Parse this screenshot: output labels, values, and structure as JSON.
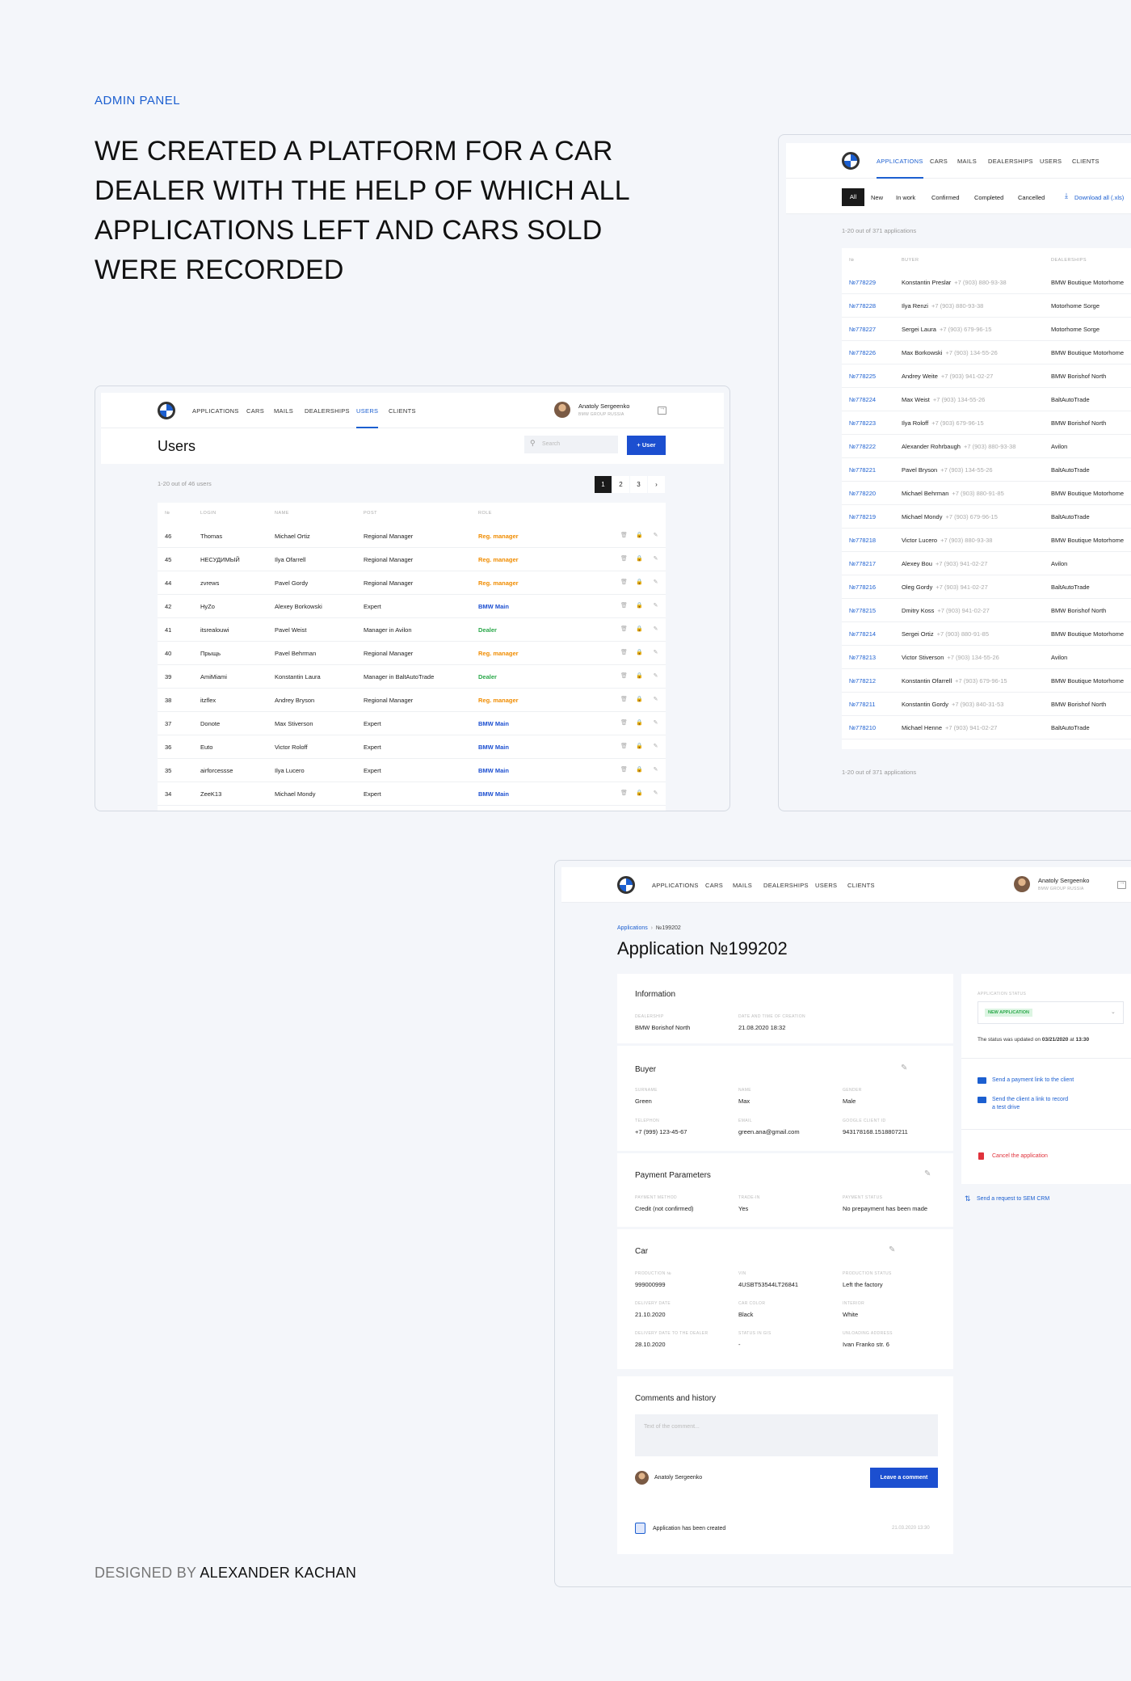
{
  "intro": {
    "eyebrow": "ADMIN PANEL",
    "headline": "WE CREATED A PLATFORM FOR A CAR DEALER WITH THE HELP OF WHICH ALL APPLICATIONS LEFT AND CARS SOLD WERE RECORDED",
    "credit_prefix": "DESIGNED BY",
    "credit_name": "ALEXANDER KACHAN"
  },
  "nav": {
    "applications": "APPLICATIONS",
    "cars": "CARS",
    "mails": "MAILS",
    "dealerships": "DEALERSHIPS",
    "users": "USERS",
    "clients": "CLIENTS"
  },
  "user": {
    "name": "Anatoly Sergeenko",
    "sub": "BMW GROUP RUSSIA"
  },
  "users_screen": {
    "title": "Users",
    "search_placeholder": "Search",
    "add_button": "+ User",
    "count": "1-20 out of 46 users",
    "pages": [
      "1",
      "2",
      "3",
      "›"
    ],
    "headers": [
      "№",
      "LOGIN",
      "NAME",
      "POST",
      "ROLE"
    ],
    "rows": [
      {
        "id": "46",
        "login": "Thomas",
        "name": "Michael Ortiz",
        "post": "Regional Manager",
        "role": "Reg. manager",
        "rt": "reg"
      },
      {
        "id": "45",
        "login": "НЕСУДИМЫЙ",
        "name": "Ilya Ofarrell",
        "post": "Regional Manager",
        "role": "Reg. manager",
        "rt": "reg"
      },
      {
        "id": "44",
        "login": "zvrews",
        "name": "Pavel Gordy",
        "post": "Regional Manager",
        "role": "Reg. manager",
        "rt": "reg"
      },
      {
        "id": "42",
        "login": "HyZo",
        "name": "Alexey Borkowski",
        "post": "Expert",
        "role": "BMW Main",
        "rt": "bmw"
      },
      {
        "id": "41",
        "login": "itsrealouwi",
        "name": "Pavel Weist",
        "post": "Manager in Avilon",
        "role": "Dealer",
        "rt": "dealer"
      },
      {
        "id": "40",
        "login": "Прыщь",
        "name": "Pavel Behrman",
        "post": "Regional Manager",
        "role": "Reg. manager",
        "rt": "reg"
      },
      {
        "id": "39",
        "login": "AmiMiami",
        "name": "Konstantin Laura",
        "post": "Manager in BaltAutoTrade",
        "role": "Dealer",
        "rt": "dealer"
      },
      {
        "id": "38",
        "login": "itzflex",
        "name": "Andrey Bryson",
        "post": "Regional Manager",
        "role": "Reg. manager",
        "rt": "reg"
      },
      {
        "id": "37",
        "login": "Donote",
        "name": "Max Stiverson",
        "post": "Expert",
        "role": "BMW Main",
        "rt": "bmw"
      },
      {
        "id": "36",
        "login": "Euto",
        "name": "Victor Roloff",
        "post": "Expert",
        "role": "BMW Main",
        "rt": "bmw"
      },
      {
        "id": "35",
        "login": "airforcessse",
        "name": "Ilya Lucero",
        "post": "Expert",
        "role": "BMW Main",
        "rt": "bmw"
      },
      {
        "id": "34",
        "login": "ZeeK13",
        "name": "Michael Mondy",
        "post": "Expert",
        "role": "BMW Main",
        "rt": "bmw"
      }
    ]
  },
  "apps_screen": {
    "filters": [
      "All",
      "New",
      "In work",
      "Confirmed",
      "Completed",
      "Cancelled"
    ],
    "download": "Download all (.xls)",
    "count": "1-20 out of 371 applications",
    "headers": [
      "№",
      "BUYER",
      "DEALERSHIPS"
    ],
    "rows": [
      {
        "id": "№778229",
        "buyer": "Konstantin Preslar",
        "phone": "+7 (903) 880-93-38",
        "dealer": "BMW Boutique Motorhome"
      },
      {
        "id": "№778228",
        "buyer": "Ilya Renzi",
        "phone": "+7 (903) 880-93-38",
        "dealer": "Motorhome Sorge"
      },
      {
        "id": "№778227",
        "buyer": "Sergei Laura",
        "phone": "+7 (903) 679-96-15",
        "dealer": "Motorhome Sorge"
      },
      {
        "id": "№778226",
        "buyer": "Max Borkowski",
        "phone": "+7 (903) 134-55-26",
        "dealer": "BMW Boutique Motorhome"
      },
      {
        "id": "№778225",
        "buyer": "Andrey Weite",
        "phone": "+7 (903) 941-02-27",
        "dealer": "BMW Borishof North"
      },
      {
        "id": "№778224",
        "buyer": "Max Weist",
        "phone": "+7 (903) 134-55-26",
        "dealer": "BaltAutoTrade"
      },
      {
        "id": "№778223",
        "buyer": "Ilya Roloff",
        "phone": "+7 (903) 679-96-15",
        "dealer": "BMW Borishof North"
      },
      {
        "id": "№778222",
        "buyer": "Alexander Rohrbaugh",
        "phone": "+7 (903) 880-93-38",
        "dealer": "Avilon"
      },
      {
        "id": "№778221",
        "buyer": "Pavel Bryson",
        "phone": "+7 (903) 134-55-26",
        "dealer": "BaltAutoTrade"
      },
      {
        "id": "№778220",
        "buyer": "Michael Behrman",
        "phone": "+7 (903) 880-91-85",
        "dealer": "BMW Boutique Motorhome"
      },
      {
        "id": "№778219",
        "buyer": "Michael Mondy",
        "phone": "+7 (903) 679-96-15",
        "dealer": "BaltAutoTrade"
      },
      {
        "id": "№778218",
        "buyer": "Victor Lucero",
        "phone": "+7 (903) 880-93-38",
        "dealer": "BMW Boutique Motorhome"
      },
      {
        "id": "№778217",
        "buyer": "Alexey Bou",
        "phone": "+7 (903) 941-02-27",
        "dealer": "Avilon"
      },
      {
        "id": "№778216",
        "buyer": "Oleg Gordy",
        "phone": "+7 (903) 941-02-27",
        "dealer": "BaltAutoTrade"
      },
      {
        "id": "№778215",
        "buyer": "Dmitry Koss",
        "phone": "+7 (903) 941-02-27",
        "dealer": "BMW Borishof North"
      },
      {
        "id": "№778214",
        "buyer": "Sergei Ortiz",
        "phone": "+7 (903) 880-91-85",
        "dealer": "BMW Boutique Motorhome"
      },
      {
        "id": "№778213",
        "buyer": "Victor Stiverson",
        "phone": "+7 (903) 134-55-26",
        "dealer": "Avilon"
      },
      {
        "id": "№778212",
        "buyer": "Konstantin Ofarrell",
        "phone": "+7 (903) 679-96-15",
        "dealer": "BMW Boutique Motorhome"
      },
      {
        "id": "№778211",
        "buyer": "Konstantin Gordy",
        "phone": "+7 (903) 840-31-53",
        "dealer": "BMW Borishof North"
      },
      {
        "id": "№778210",
        "buyer": "Michael Henne",
        "phone": "+7 (903) 941-02-27",
        "dealer": "BaltAutoTrade"
      }
    ],
    "footer_count": "1-20 out of 371 applications"
  },
  "detail_screen": {
    "breadcrumb_root": "Applications",
    "breadcrumb_current": "№199202",
    "title": "Application №199202",
    "information": {
      "title": "Information",
      "dealership_label": "DEALERSHIP",
      "dealership": "BMW Borishof North",
      "date_label": "DATE AND TIME OF CREATION",
      "date": "21.08.2020 18:32"
    },
    "buyer": {
      "title": "Buyer",
      "surname_label": "SURNAME",
      "surname": "Green",
      "name_label": "NAME",
      "name": "Max",
      "gender_label": "GENDER",
      "gender": "Male",
      "phone_label": "TELEPHON",
      "phone": "+7 (999) 123-45-67",
      "email_label": "EMAIL",
      "email": "green.ana@gmail.com",
      "gid_label": "GOOGLE CLIENT ID",
      "gid": "943178168.1518807211"
    },
    "payment": {
      "title": "Payment Parameters",
      "method_label": "PAYMENT METHOD",
      "method": "Credit (not confirmed)",
      "trade_label": "TRADE-IN",
      "trade": "Yes",
      "status_label": "PAYMENT STATUS",
      "status": "No prepayment has been made"
    },
    "car": {
      "title": "Car",
      "prod_label": "PRODUCTION №",
      "prod": "999000999",
      "vin_label": "VIN",
      "vin": "4USBT53544LT26841",
      "pstatus_label": "PRODUCTION STATUS",
      "pstatus": "Left the factory",
      "ddate_label": "DELIVERY DATE",
      "ddate": "21.10.2020",
      "color_label": "CAR COLOR",
      "color": "Black",
      "interior_label": "INTERIOR",
      "interior": "White",
      "dealerdate_label": "DELIVERY DATE TO THE DEALER",
      "dealerdate": "28.10.2020",
      "gis_label": "STATUS IN GIS",
      "gis": "-",
      "unload_label": "UNLOADING ADDRESS",
      "unload": "Ivan Franko str. 6"
    },
    "comments": {
      "title": "Comments and history",
      "placeholder": "Text of the comment...",
      "author": "Anatoly Sergeenko",
      "button": "Leave a comment",
      "history_text": "Application has been created",
      "history_date": "21.03.2020 13:30"
    },
    "status_panel": {
      "label": "APPLICATION STATUS",
      "badge": "NEW APPLICATION",
      "updated_prefix": "The status was updated on",
      "updated_date": "03/21/2020",
      "updated_at": "at",
      "updated_time": "13:30",
      "link_payment": "Send a payment link to the client",
      "link_testdrive_1": "Send the client a link to record",
      "link_testdrive_2": "a test drive",
      "cancel": "Cancel the application",
      "crm": "Send a request to SEM CRM"
    }
  },
  "colors": {
    "accent": "#1c5fd0",
    "reg_manager": "#f08c00",
    "bmw_main": "#1c4fd0",
    "dealer": "#2aa84a",
    "danger": "#e0323c"
  }
}
